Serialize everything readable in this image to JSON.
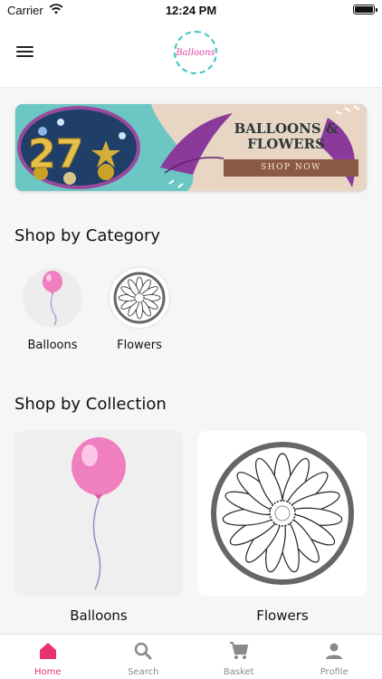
{
  "status_bar": {
    "carrier": "Carrier",
    "time": "12:24 PM"
  },
  "header": {
    "logo_text": "Balloons"
  },
  "banner": {
    "number": "27",
    "headline": "BALLOONS &\nFLOWERS",
    "cta": "SHOP NOW"
  },
  "category_section": {
    "title": "Shop by Category",
    "items": [
      {
        "label": "Balloons",
        "icon": "pink-balloon"
      },
      {
        "label": "Flowers",
        "icon": "daisy-flower"
      }
    ]
  },
  "collection_section": {
    "title": "Shop by Collection",
    "items": [
      {
        "label": "Balloons",
        "icon": "pink-balloon"
      },
      {
        "label": "Flowers",
        "icon": "daisy-flower"
      }
    ]
  },
  "tab_bar": {
    "active_color": "#e8336f",
    "items": [
      {
        "label": "Home",
        "icon": "home-icon",
        "active": true
      },
      {
        "label": "Search",
        "icon": "search-icon",
        "active": false
      },
      {
        "label": "Basket",
        "icon": "cart-icon",
        "active": false
      },
      {
        "label": "Profile",
        "icon": "person-icon",
        "active": false
      }
    ]
  }
}
